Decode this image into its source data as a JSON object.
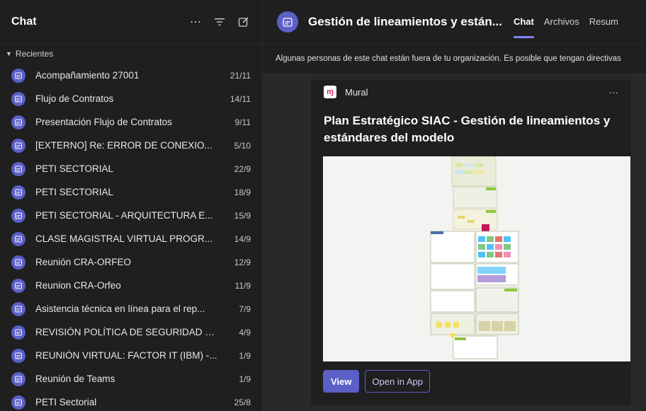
{
  "sidebar": {
    "title": "Chat",
    "actions": {
      "more_icon": "more-icon",
      "filter_icon": "filter-icon",
      "compose_icon": "compose-icon"
    },
    "section_label": "Recientes",
    "items": [
      {
        "name": "Acompañamiento 27001",
        "date": "21/11"
      },
      {
        "name": "Flujo de Contratos",
        "date": "14/11"
      },
      {
        "name": "Presentación Flujo de Contratos",
        "date": "9/11"
      },
      {
        "name": "[EXTERNO] Re: ERROR DE CONEXIO...",
        "date": "5/10"
      },
      {
        "name": "PETI SECTORIAL",
        "date": "22/9"
      },
      {
        "name": "PETI SECTORIAL",
        "date": "18/9"
      },
      {
        "name": "PETI SECTORIAL - ARQUITECTURA E...",
        "date": "15/9"
      },
      {
        "name": "CLASE MAGISTRAL VIRTUAL PROGR...",
        "date": "14/9"
      },
      {
        "name": "Reunión CRA-ORFEO",
        "date": "12/9"
      },
      {
        "name": "Reunion CRA-Orfeo",
        "date": "11/9"
      },
      {
        "name": "Asistencia técnica en línea para el rep...",
        "date": "7/9"
      },
      {
        "name": "REVISIÓN POLÍTICA DE SEGURIDAD D...",
        "date": "4/9"
      },
      {
        "name": "REUNIÓN VIRTUAL: FACTOR IT (IBM) -...",
        "date": "1/9"
      },
      {
        "name": "Reunión de Teams",
        "date": "1/9"
      },
      {
        "name": "PETI Sectorial",
        "date": "25/8"
      }
    ]
  },
  "header": {
    "topic": "Gestión de lineamientos y están...",
    "tabs": [
      {
        "label": "Chat",
        "active": true
      },
      {
        "label": "Archivos",
        "active": false
      },
      {
        "label": "Resum",
        "active": false
      }
    ]
  },
  "notice": "Algunas personas de este chat están fuera de tu organización. Es posible que tengan directivas",
  "card": {
    "app_name": "Mural",
    "logo_text": "ɱ",
    "more": "···",
    "title": "Plan Estratégico SIAC - Gestión de lineamientos y estándares del modelo",
    "view_label": "View",
    "open_label": "Open in App"
  },
  "colors": {
    "accent": "#5b5fc7",
    "tab_underline": "#7f85f5",
    "background": "#1f1f1f",
    "main_background": "#292929"
  }
}
